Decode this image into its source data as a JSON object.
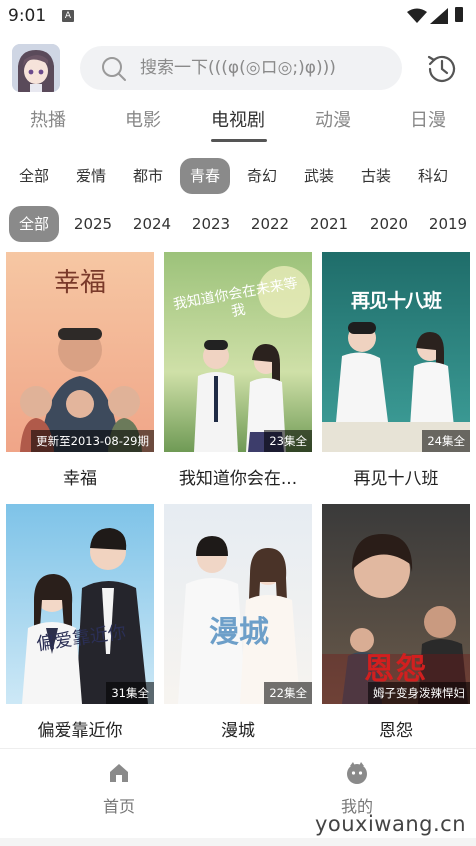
{
  "status_bar": {
    "time": "9:01",
    "notification_icon": "A"
  },
  "header": {
    "search_placeholder": "搜索一下(((φ(◎ロ◎;)φ)))"
  },
  "category_tabs": [
    {
      "label": "热播",
      "active": false
    },
    {
      "label": "电影",
      "active": false
    },
    {
      "label": "电视剧",
      "active": true
    },
    {
      "label": "动漫",
      "active": false
    },
    {
      "label": "日漫",
      "active": false
    }
  ],
  "genre_filters": [
    {
      "label": "全部",
      "active": false
    },
    {
      "label": "爱情",
      "active": false
    },
    {
      "label": "都市",
      "active": false
    },
    {
      "label": "青春",
      "active": true
    },
    {
      "label": "奇幻",
      "active": false
    },
    {
      "label": "武装",
      "active": false
    },
    {
      "label": "古装",
      "active": false
    },
    {
      "label": "科幻",
      "active": false
    }
  ],
  "year_filters": [
    {
      "label": "全部",
      "active": true
    },
    {
      "label": "2025",
      "active": false
    },
    {
      "label": "2024",
      "active": false
    },
    {
      "label": "2023",
      "active": false
    },
    {
      "label": "2022",
      "active": false
    },
    {
      "label": "2021",
      "active": false
    },
    {
      "label": "2020",
      "active": false
    },
    {
      "label": "2019",
      "active": false
    }
  ],
  "dramas": [
    {
      "title": "幸福",
      "badge": "更新至2013-08-29期",
      "poster_text": "幸福"
    },
    {
      "title": "我知道你会在...",
      "badge": "23集全",
      "poster_text": "我知道你会在未来等我"
    },
    {
      "title": "再见十八班",
      "badge": "24集全",
      "poster_text": "再见十八班"
    },
    {
      "title": "偏爱靠近你",
      "badge": "31集全",
      "poster_text": "偏爱靠近你"
    },
    {
      "title": "漫城",
      "badge": "22集全",
      "poster_text": "漫城"
    },
    {
      "title": "恩怨",
      "badge": "姆子变身泼辣悍妇",
      "poster_text": "恩怨"
    }
  ],
  "bottom_nav": [
    {
      "label": "首页",
      "icon": "home-icon"
    },
    {
      "label": "我的",
      "icon": "profile-icon"
    }
  ],
  "watermark": "youxiwang.cn"
}
